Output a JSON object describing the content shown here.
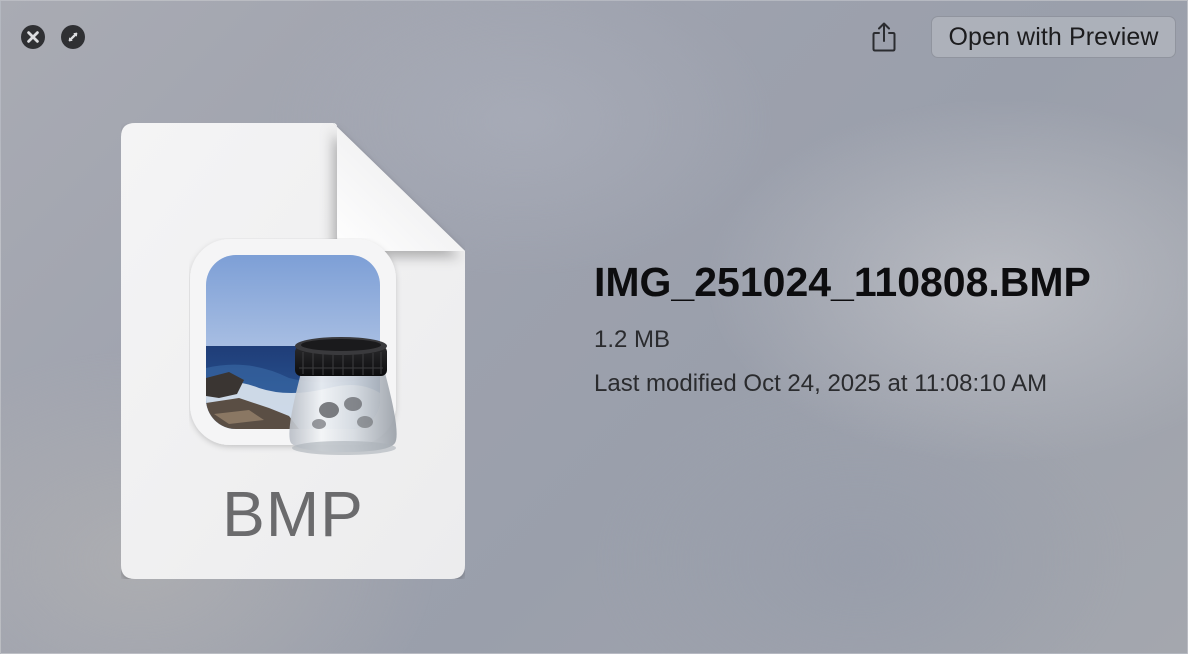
{
  "window": {
    "controls": {
      "close_icon": "close-icon",
      "fullscreen_icon": "fullscreen-icon"
    },
    "toolbar": {
      "share_icon": "share-icon",
      "open_with_label": "Open with Preview"
    }
  },
  "preview": {
    "doc_type_label": "BMP",
    "app_icon": "preview-app-icon"
  },
  "file": {
    "name": "IMG_251024_110808.BMP",
    "size": "1.2 MB",
    "modified": "Last modified Oct 24, 2025 at 11:08:10 AM"
  },
  "colors": {
    "background": "#9fa3ae",
    "control_fill": "#2f3033",
    "text_primary": "#0d0d0f",
    "text_secondary": "#2a2b2e",
    "doc_label": "#6b6b6d"
  }
}
